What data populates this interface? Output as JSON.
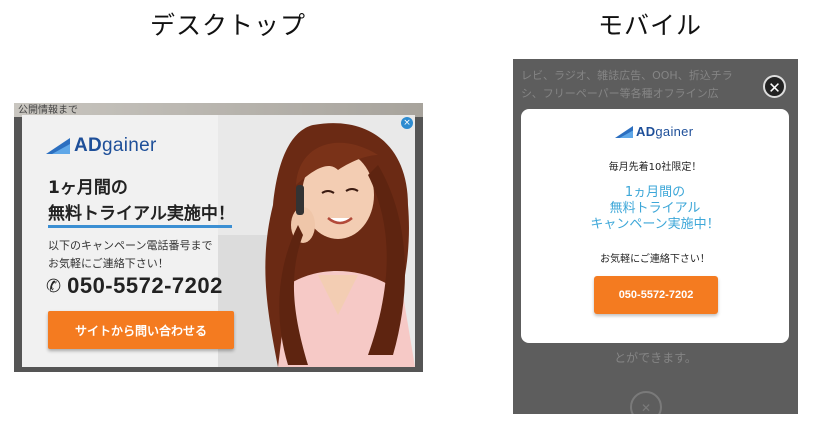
{
  "headings": {
    "desktop": "デスクトップ",
    "mobile": "モバイル"
  },
  "brand": {
    "logo_text_bold": "AD",
    "logo_text_rest": "gainer",
    "logo_icon": "adgainer-logo-icon",
    "color": "#1e4f99"
  },
  "colors": {
    "accent_orange": "#f47b20",
    "accent_blue": "#3b8fd3",
    "mobile_text_blue": "#3da7d8"
  },
  "desktop": {
    "bg_text": "公開情報まで",
    "headline_line1": "1ヶ月間の",
    "headline_line2": "無料トライアル実施中！",
    "sub_line1": "以下のキャンペーン電話番号まで",
    "sub_line2": "お気軽にご連絡下さい！",
    "phone_icon": "phone-icon",
    "phone_number": "050-5572-7202",
    "cta_label": "サイトから問い合わせる",
    "close_icon": "close-icon"
  },
  "mobile": {
    "bg_text_line1": "レビ、ラジオ、雑誌広告、OOH、折込チラ",
    "bg_text_line2": "シ、フリーペーパー等各種オフライン広",
    "close_icon": "close-icon",
    "limited_text": "毎月先着10社限定！",
    "headline_line1": "1ヵ月間の",
    "headline_line2": "無料トライアル",
    "headline_line3": "キャンペーン実施中！",
    "contact_text": "お気軽にご連絡下さい！",
    "phone_button": "050-5572-7202",
    "bottom_text": "とができます。"
  }
}
